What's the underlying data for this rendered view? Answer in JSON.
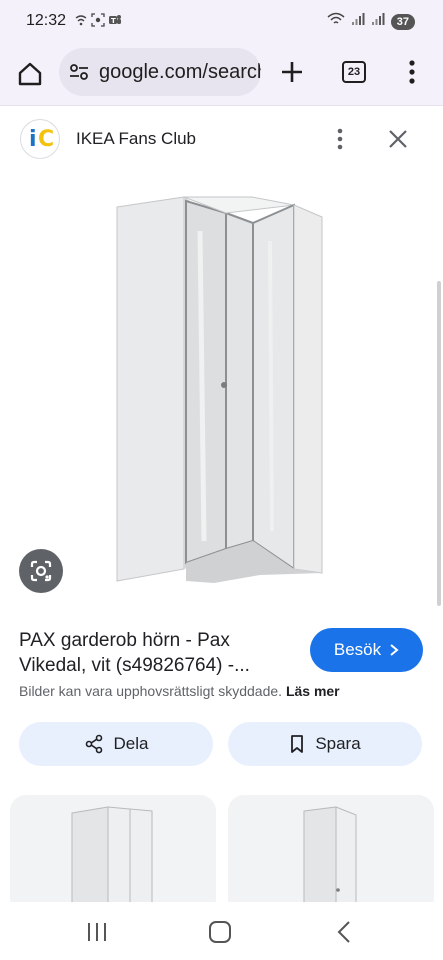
{
  "status_bar": {
    "time": "12:32",
    "battery": "37",
    "icons": [
      "wifi-calling-icon",
      "screen-record-icon",
      "teams-icon",
      "wifi-icon",
      "signal-icon",
      "signal-icon-2"
    ]
  },
  "browser": {
    "url": "google.com/search",
    "tab_count": "23",
    "icons": [
      "home-icon",
      "tune-icon",
      "plus-icon",
      "tabs-icon",
      "more-vert-icon"
    ]
  },
  "source": {
    "name": "IKEA Fans Club",
    "logo_letters": [
      "i",
      "C"
    ],
    "icons": [
      "more-vert-icon",
      "close-icon"
    ]
  },
  "result": {
    "title_line1": "PAX garderob hörn - Pax",
    "title_line2": "Vikedal, vit (s49826764) -...",
    "visit_label": "Besök",
    "copyright_text": "Bilder kan vara upphovsrättsligt skyddade.",
    "learn_more": "Läs mer",
    "share_label": "Dela",
    "save_label": "Spara"
  },
  "colors": {
    "accent_blue": "#1a73e8",
    "chip_bg": "#e8f0fe",
    "toolbar_bg": "#f5f1fa",
    "logo_blue": "#1a73c4",
    "logo_yellow": "#f4c20d"
  }
}
